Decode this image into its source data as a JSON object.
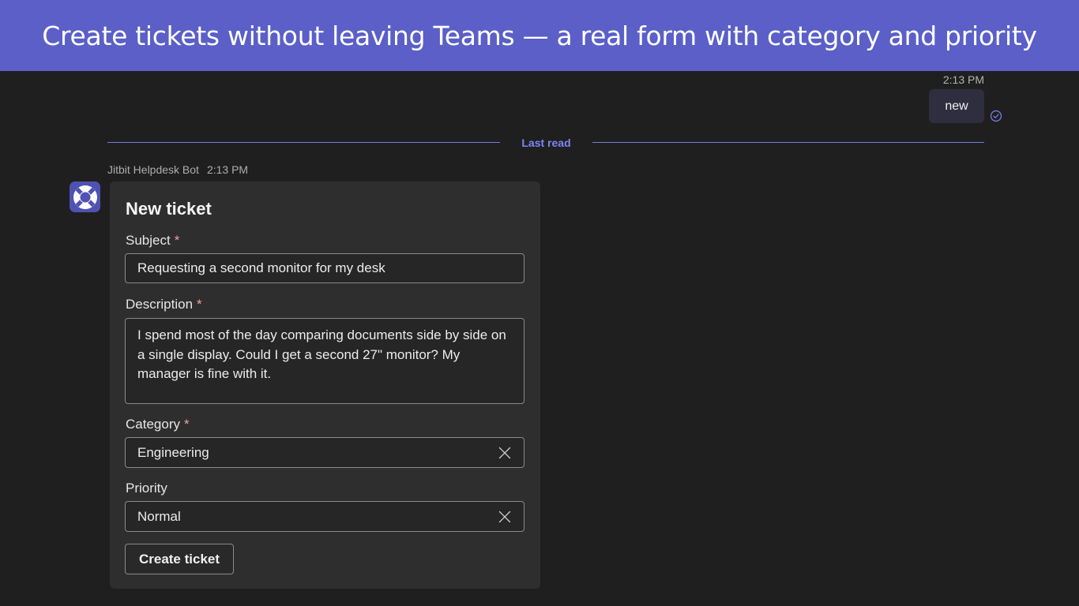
{
  "banner": {
    "text": "Create tickets without leaving Teams — a real form with category and priority"
  },
  "sent_message": {
    "time": "2:13 PM",
    "text": "new",
    "status_icon": "read-check-icon"
  },
  "divider": {
    "label": "Last read"
  },
  "bot_message": {
    "sender": "Jitbit Helpdesk Bot",
    "time": "2:13 PM",
    "avatar_icon": "lifebuoy-icon"
  },
  "card": {
    "title": "New ticket",
    "required_marker": "*",
    "subject": {
      "label": "Subject",
      "value": "Requesting a second monitor for my desk"
    },
    "description": {
      "label": "Description",
      "value": "I spend most of the day comparing documents side by side on a single display. Could I get a second 27\" monitor? My manager is fine with it."
    },
    "category": {
      "label": "Category",
      "value": "Engineering"
    },
    "priority": {
      "label": "Priority",
      "value": "Normal"
    },
    "submit_label": "Create ticket"
  },
  "colors": {
    "banner": "#5b5fc7",
    "background": "#1f1f1f",
    "card": "#2e2e2e",
    "accent": "#7f85f5",
    "required": "#e9a0a8"
  }
}
